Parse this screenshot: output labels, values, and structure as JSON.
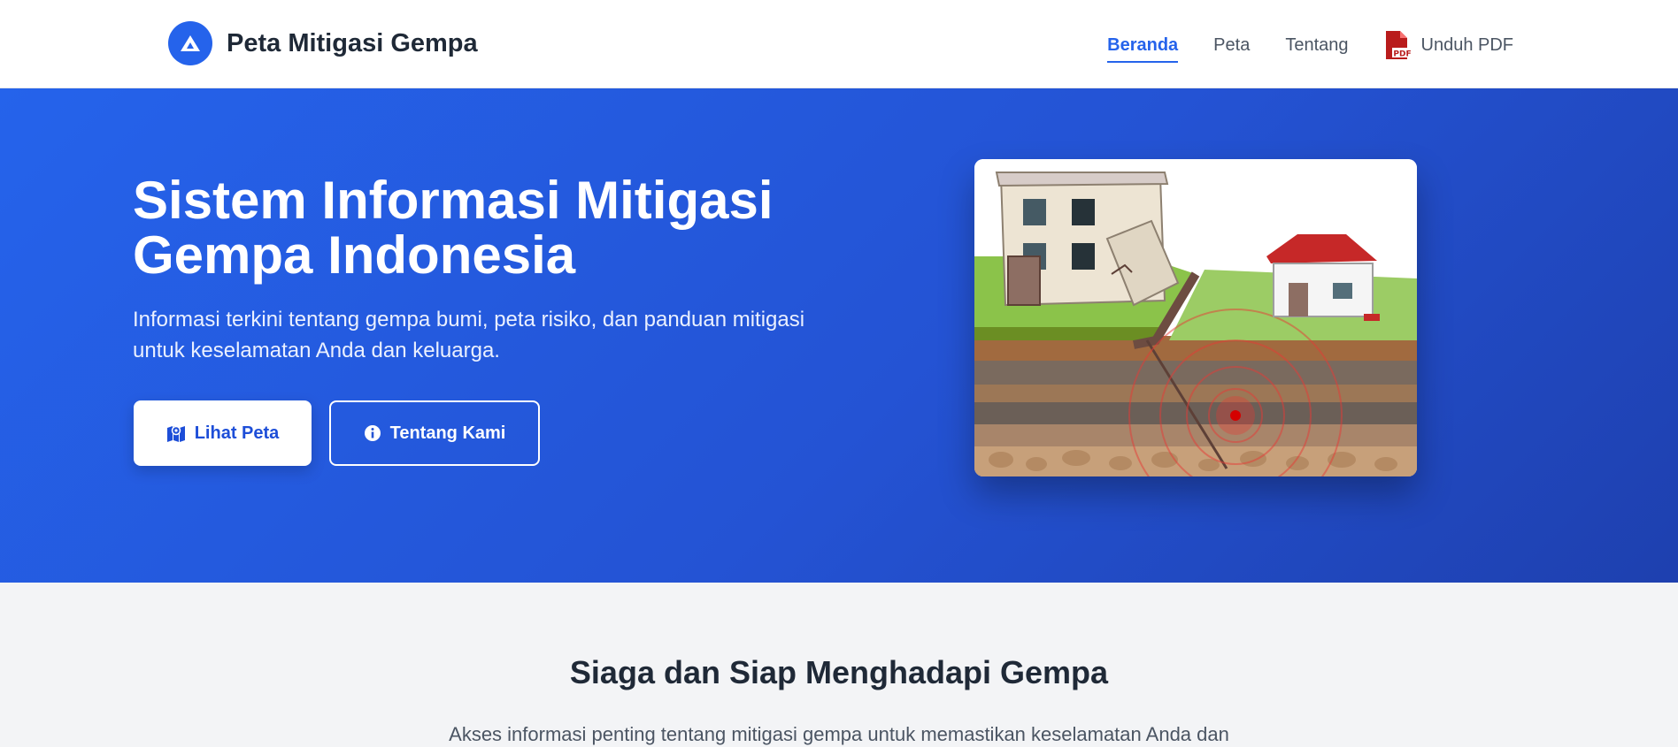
{
  "brand": {
    "title": "Peta Mitigasi Gempa",
    "logo_icon": "mountain-icon",
    "accent": "#2563eb"
  },
  "nav": {
    "items": [
      {
        "label": "Beranda",
        "active": true
      },
      {
        "label": "Peta",
        "active": false
      },
      {
        "label": "Tentang",
        "active": false
      }
    ],
    "pdf": {
      "label": "Unduh PDF",
      "icon": "pdf-file-icon",
      "icon_color": "#b91c1c",
      "badge": "PDF"
    }
  },
  "hero": {
    "title": "Sistem Informasi Mitigasi Gempa Indonesia",
    "subtitle": "Informasi terkini tentang gempa bumi, peta risiko, dan panduan mitigasi untuk keselamatan Anda dan keluarga.",
    "primary_button": {
      "label": "Lihat Peta",
      "icon": "map-icon"
    },
    "secondary_button": {
      "label": "Tentang Kami",
      "icon": "info-circle-icon"
    },
    "gradient": [
      "#2563eb",
      "#1e40af"
    ]
  },
  "info": {
    "title": "Siaga dan Siap Menghadapi Gempa",
    "subtitle": "Akses informasi penting tentang mitigasi gempa untuk memastikan keselamatan Anda dan"
  }
}
